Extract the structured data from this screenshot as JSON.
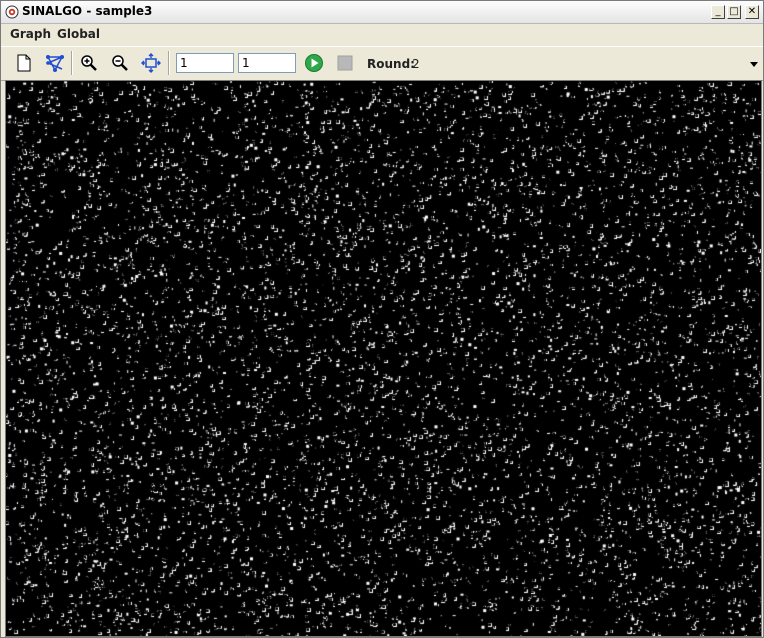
{
  "window": {
    "title": "SINALGO - sample3",
    "app_icon": "sinalgo-logo-icon",
    "controls": {
      "minimize_label": "_",
      "maximize_label": "□",
      "close_label": "✕"
    }
  },
  "menubar": {
    "items": [
      {
        "label": "Graph"
      },
      {
        "label": "Global"
      }
    ]
  },
  "toolbar": {
    "new_icon": "new-document-icon",
    "graph_icon": "graph-connectivity-icon",
    "zoom_in_icon": "zoom-in-icon",
    "zoom_out_icon": "zoom-out-icon",
    "zoom_fit_icon": "zoom-to-fit-icon",
    "rounds_input_value": "1",
    "refresh_rate_input_value": "1",
    "run_icon": "run-play-icon",
    "stop_icon": "stop-icon",
    "round_label": "Round:",
    "round_value": "2",
    "dropdown_icon": "chevron-down-icon"
  },
  "canvas": {
    "background": "#000000",
    "node_color": "#ffffff",
    "content": "dense-random-node-field"
  }
}
